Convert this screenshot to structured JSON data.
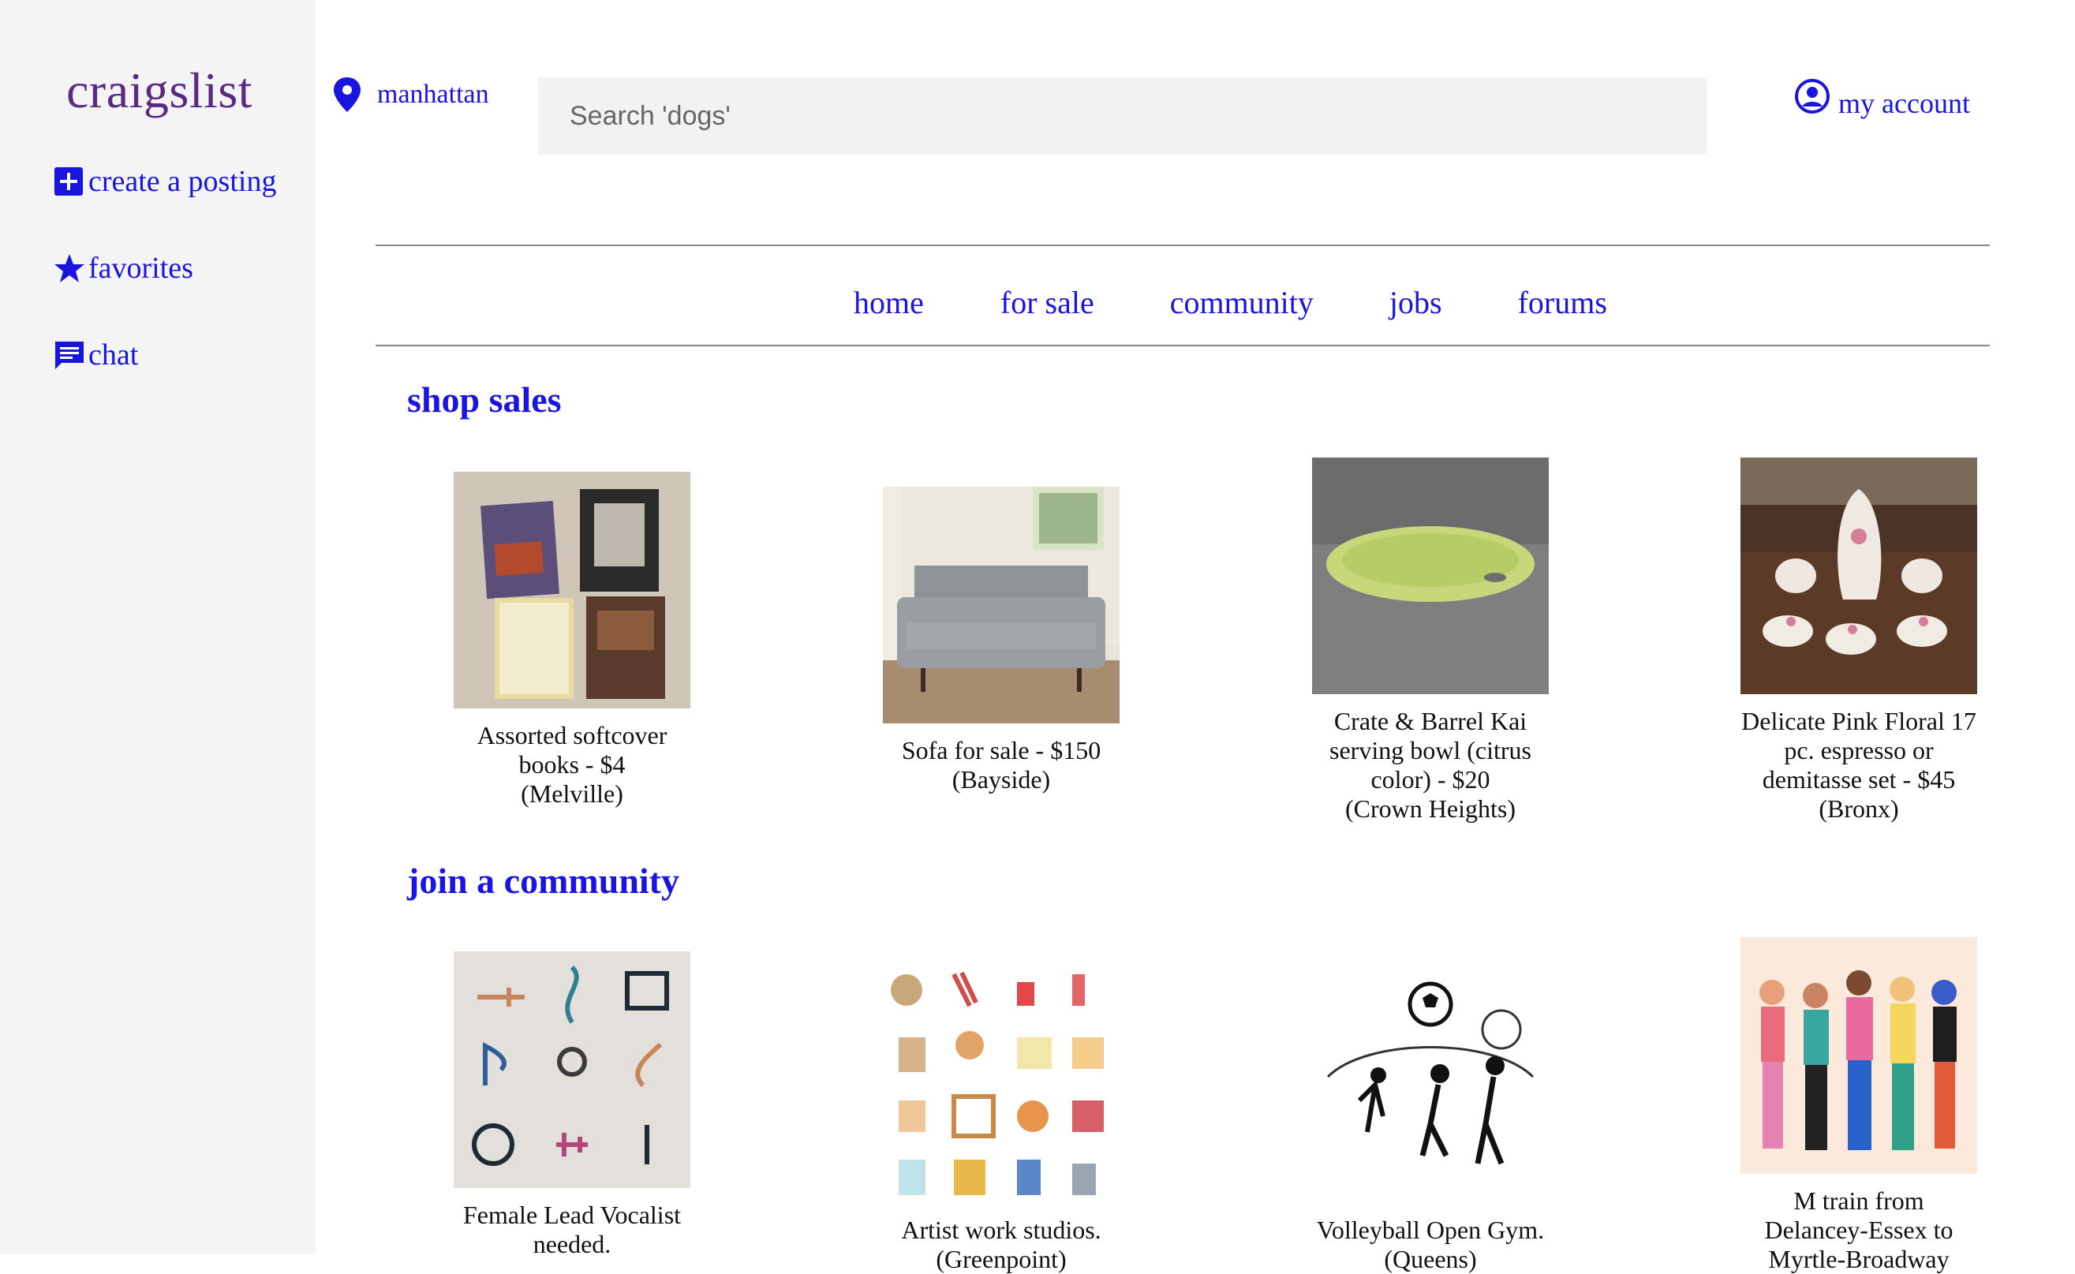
{
  "sidebar": {
    "logo": "craigslist",
    "items": [
      {
        "label": "create a posting",
        "icon": "plus-box-icon"
      },
      {
        "label": "favorites",
        "icon": "star-icon"
      },
      {
        "label": "chat",
        "icon": "chat-icon"
      }
    ]
  },
  "header": {
    "location": "manhattan",
    "search_placeholder": "Search 'dogs'",
    "account_label": "my account"
  },
  "nav": [
    "home",
    "for sale",
    "community",
    "jobs",
    "forums"
  ],
  "sections": {
    "sales": {
      "title": "shop sales",
      "items": [
        {
          "line1": "Assorted softcover",
          "line2": "books - $4",
          "line3": "(Melville)",
          "line4": ""
        },
        {
          "line1": "Sofa for sale - $150",
          "line2": "(Bayside)",
          "line3": "",
          "line4": ""
        },
        {
          "line1": "Crate & Barrel Kai",
          "line2": "serving bowl (citrus",
          "line3": "color) - $20",
          "line4": "(Crown Heights)"
        },
        {
          "line1": "Delicate Pink Floral 17",
          "line2": "pc. espresso or",
          "line3": "demitasse set - $45",
          "line4": "(Bronx)"
        }
      ]
    },
    "community": {
      "title": "join a community",
      "items": [
        {
          "line1": "Female Lead Vocalist",
          "line2": "needed."
        },
        {
          "line1": "Artist work studios.",
          "line2": "(Greenpoint)"
        },
        {
          "line1": "Volleyball Open Gym.",
          "line2": "(Queens)"
        },
        {
          "line1": "M train from",
          "line2": "Delancey-Essex to",
          "line3": "Myrtle-Broadway"
        }
      ]
    }
  },
  "colors": {
    "link": "#1a14e0",
    "logo": "#5a2a84",
    "sidebar_bg": "#f4f4f4",
    "search_bg": "#f2f2f2"
  }
}
